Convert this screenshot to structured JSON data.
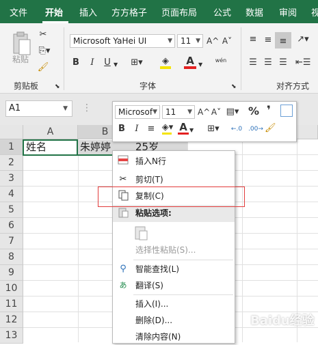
{
  "menu": {
    "items": [
      "文件",
      "开始",
      "插入",
      "方方格子",
      "页面布局",
      "公式",
      "数据",
      "审阅",
      "视"
    ],
    "active": "开始"
  },
  "ribbon": {
    "clipboard_label": "剪贴板",
    "paste_label": "粘贴",
    "font_label": "字体",
    "align_label": "对齐方式",
    "font_name": "Microsoft YaHei UI",
    "font_size": "11",
    "bold": "B",
    "italic": "I",
    "underline": "U",
    "grow_font": "A^",
    "shrink_font": "A˅",
    "phonetic": "wén",
    "font_color_letter": "A"
  },
  "formula_bar": {
    "name_box": "A1"
  },
  "grid": {
    "columns": [
      "A",
      "B"
    ],
    "rows": [
      "1",
      "2",
      "3",
      "4",
      "5",
      "6",
      "7",
      "8",
      "9",
      "10",
      "11",
      "12",
      "13"
    ],
    "cells": {
      "A1": "姓名",
      "B1": "朱婷婷",
      "C1": "25岁"
    }
  },
  "mini_toolbar": {
    "font_name": "Microsof",
    "font_size": "11",
    "percent": "%",
    "comma": "❜",
    "bold": "B",
    "italic": "I",
    "font_color_letter": "A",
    "inc_decimal": "←.0",
    "dec_decimal": ".00→"
  },
  "context_menu": {
    "items": [
      {
        "label": "插入N行",
        "icon": "insert-rows-icon",
        "enabled": true
      },
      {
        "label": "剪切(T)",
        "icon": "scissors-icon",
        "enabled": true
      },
      {
        "label": "复制(C)",
        "icon": "copy-icon",
        "enabled": true
      },
      {
        "label": "粘贴选项:",
        "icon": "paste-icon",
        "enabled": true
      },
      {
        "label": "选择性粘贴(S)...",
        "icon": "",
        "enabled": false
      },
      {
        "label": "智能查找(L)",
        "icon": "smart-lookup-icon",
        "enabled": true
      },
      {
        "label": "翻译(S)",
        "icon": "translate-icon",
        "enabled": true
      },
      {
        "label": "插入(I)...",
        "icon": "",
        "enabled": true
      },
      {
        "label": "删除(D)...",
        "icon": "",
        "enabled": true
      },
      {
        "label": "清除内容(N)",
        "icon": "",
        "enabled": true
      }
    ]
  },
  "watermark": "Baidu经验",
  "colors": {
    "accent": "#217346",
    "highlight_border": "#e23b3b",
    "font_color_bar": "#e32020",
    "highlight_color_bar": "#f5e400",
    "selection_fill": "#d9d9d9"
  }
}
